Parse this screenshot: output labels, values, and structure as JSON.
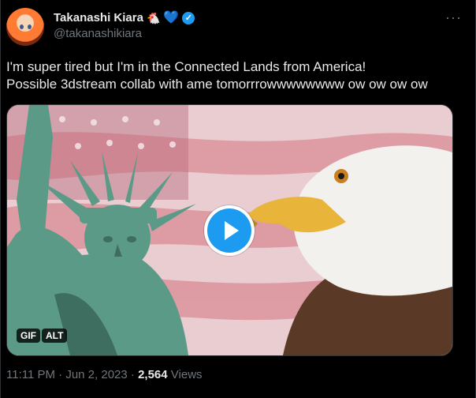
{
  "author": {
    "display_name": "Takanashi Kiara",
    "emoji_badges": [
      "🐔",
      "💙"
    ],
    "verified": true,
    "handle": "@takanashikiara"
  },
  "menu": {
    "more_label": "···"
  },
  "tweet": {
    "lines": [
      "I'm super tired but I'm in the Connected Lands from America!",
      "Possible 3dstream collab with ame tomorrrowwwwwwww ow ow ow ow"
    ]
  },
  "media": {
    "badges": [
      "GIF",
      "ALT"
    ],
    "play_icon": "play-icon"
  },
  "meta": {
    "time": "11:11 PM",
    "sep1": " · ",
    "date": "Jun 2, 2023",
    "sep2": " · ",
    "views": "2,564",
    "views_label": " Views"
  },
  "colors": {
    "background": "#000000",
    "accent": "#1d9bf0",
    "secondary_text": "#71767b"
  }
}
